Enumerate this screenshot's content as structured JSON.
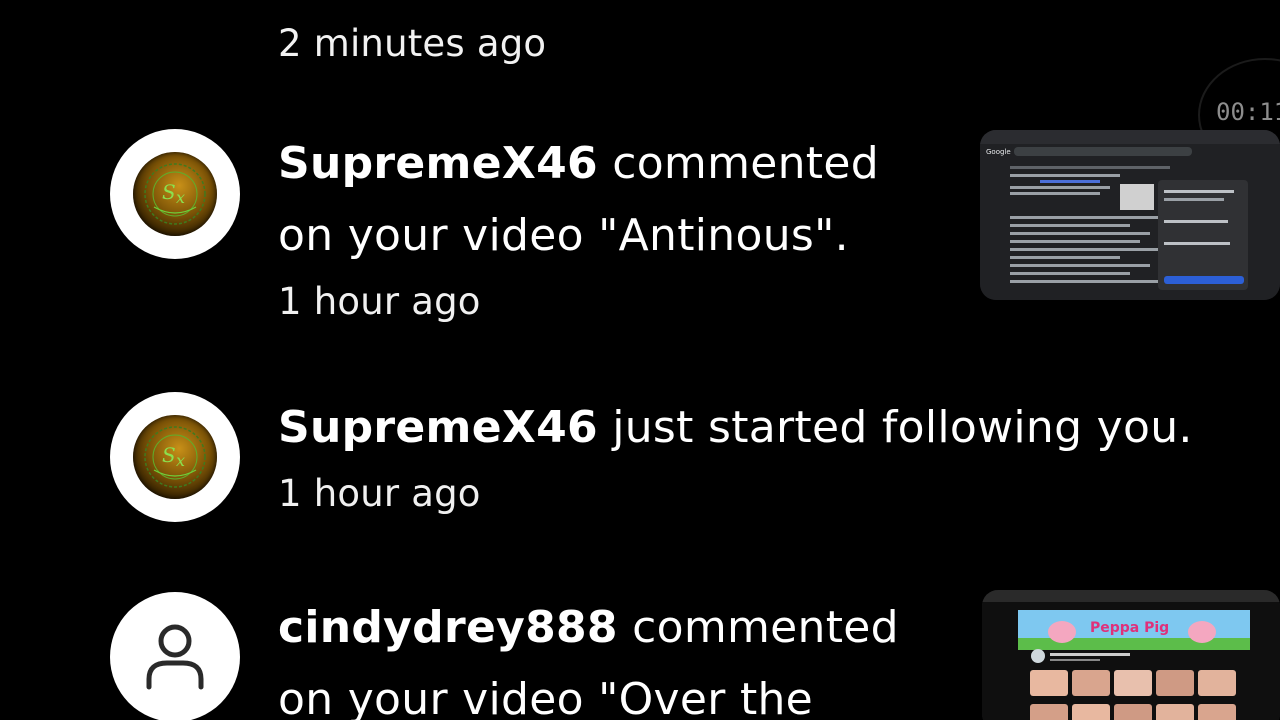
{
  "feed": {
    "top_partial": {
      "time": "2 minutes ago"
    },
    "items": [
      {
        "username": "SupremeX46",
        "action": "commented",
        "action_line2": "on your video \"Antinous\".",
        "time": "1 hour ago"
      },
      {
        "username": "SupremeX46",
        "action": "just started following you.",
        "time": "1 hour ago"
      },
      {
        "username": "cindydrey888",
        "action": "commented",
        "action_line2": "on your video \"Over the"
      }
    ]
  },
  "thumbnails": {
    "first": {
      "search_logo": "Google"
    },
    "second": {
      "banner_text": "Peppa Pig"
    }
  },
  "recorder": {
    "timer": "00:11"
  },
  "colors": {
    "background": "#000000",
    "text": "#ffffff",
    "avatar_gold": "#c89018",
    "logo_green": "#6fcf3a"
  },
  "icons": {
    "avatar_default": "person-icon",
    "avatar_logo": "sx-logo-icon"
  }
}
